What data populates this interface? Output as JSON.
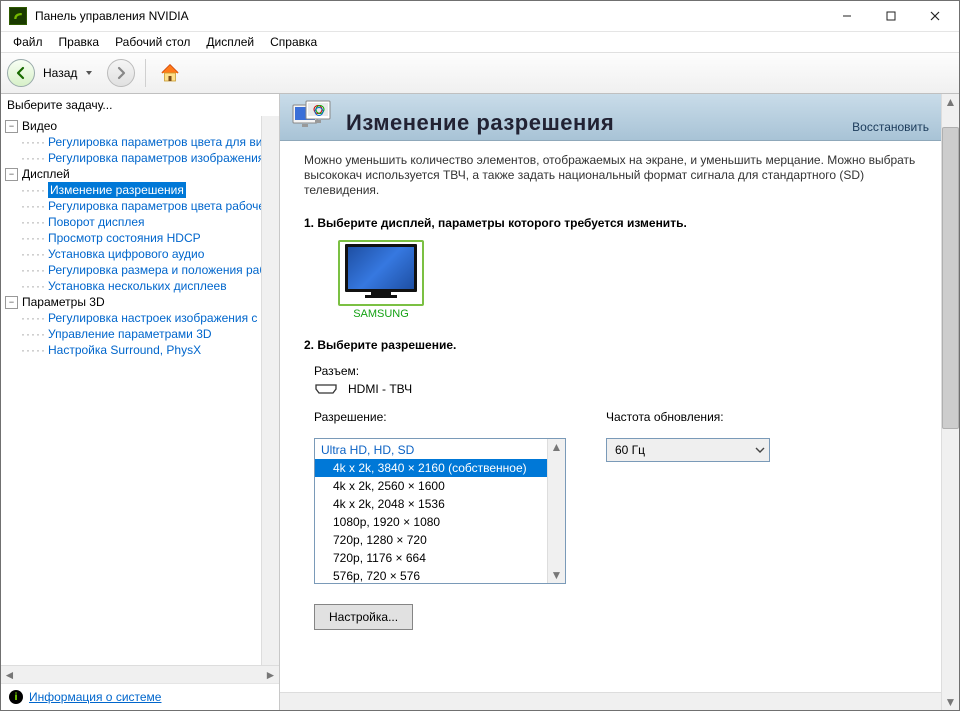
{
  "title": "Панель управления NVIDIA",
  "menus": [
    "Файл",
    "Правка",
    "Рабочий стол",
    "Дисплей",
    "Справка"
  ],
  "toolbar": {
    "back": "Назад"
  },
  "sidebar": {
    "title": "Выберите задачу...",
    "cat_video": "Видео",
    "video_items": [
      "Регулировка параметров цвета для вид",
      "Регулировка параметров изображения д"
    ],
    "cat_display": "Дисплей",
    "display_items": [
      "Изменение разрешения",
      "Регулировка параметров цвета рабочег",
      "Поворот дисплея",
      "Просмотр состояния HDCP",
      "Установка цифрового аудио",
      "Регулировка размера и положения рабо",
      "Установка нескольких дисплеев"
    ],
    "cat_3d": "Параметры 3D",
    "p3d_items": [
      "Регулировка настроек изображения с пр",
      "Управление параметрами 3D",
      "Настройка Surround, PhysX"
    ]
  },
  "footer": {
    "sysinfo": "Информация о системе"
  },
  "page": {
    "title": "Изменение разрешения",
    "restore": "Восстановить",
    "description": "Можно уменьшить количество элементов, отображаемых на экране, и уменьшить мерцание. Можно выбрать высококач используется ТВЧ, а также задать национальный формат сигнала для стандартного (SD) телевидения.",
    "step1": "1. Выберите дисплей, параметры которого требуется изменить.",
    "monitor": "SAMSUNG",
    "step2": "2. Выберите разрешение.",
    "connector_label": "Разъем:",
    "connector_value": "HDMI - ТВЧ",
    "resolution_label": "Разрешение:",
    "refresh_label": "Частота обновления:",
    "refresh_value": "60 Гц",
    "res_header": "Ultra HD, HD, SD",
    "resolutions": [
      "4k x 2k, 3840 × 2160 (собственное)",
      "4k x 2k, 2560 × 1600",
      "4k x 2k, 2048 × 1536",
      "1080p, 1920 × 1080",
      "720p, 1280 × 720",
      "720p, 1176 × 664",
      "576p, 720 × 576"
    ],
    "customize": "Настройка..."
  }
}
